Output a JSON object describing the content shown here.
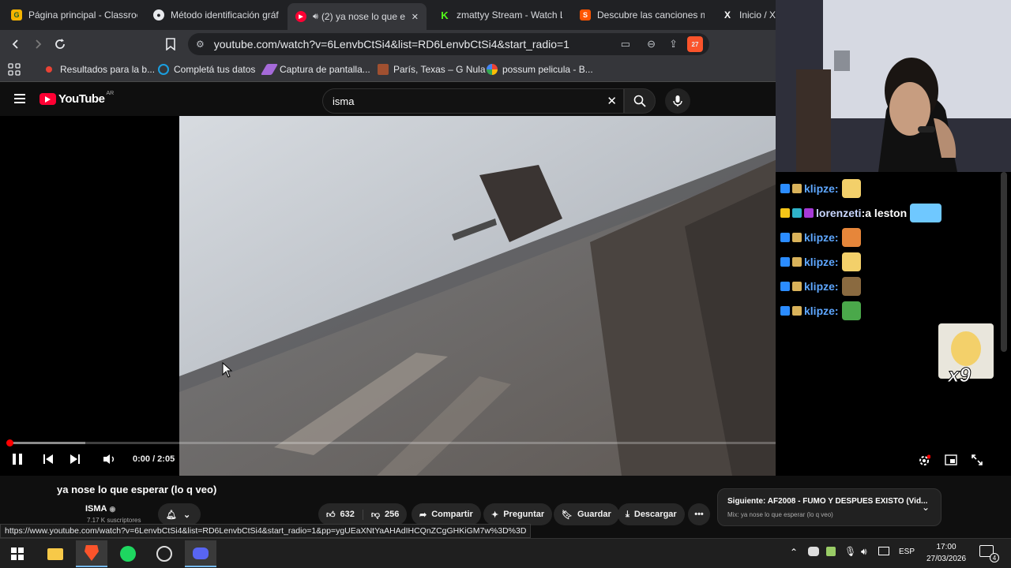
{
  "tabs": [
    {
      "title": "Página principal - Classroo",
      "fav": "G"
    },
    {
      "title": "Método identificación gráf",
      "fav": "●"
    },
    {
      "title": "(2) ya nose lo que e",
      "fav": "▶",
      "active": true
    },
    {
      "title": "zmattyy Stream - Watch Li",
      "fav": "K"
    },
    {
      "title": "Descubre las canciones m",
      "fav": "S"
    },
    {
      "title": "Inicio / X",
      "fav": "X"
    }
  ],
  "tab_close": "✕",
  "url": "youtube.com/watch?v=6LenvbCtSi4&list=RD6LenvbCtSi4&start_radio=1",
  "brave_count": "27",
  "bookmarks": [
    {
      "label": "Resultados para la b...",
      "color": "#ea4335"
    },
    {
      "label": "Completá tus datos",
      "color": "#1a9fe0"
    },
    {
      "label": "Captura de pantalla...",
      "color": "#a56ad9"
    },
    {
      "label": "París, Texas – G Nula",
      "color": "#a05030"
    },
    {
      "label": "possum pelicula - B...",
      "color": "#4285f4"
    }
  ],
  "youtube": {
    "logo": "YouTube",
    "region": "AR",
    "search_value": "isma"
  },
  "player": {
    "time": "0:00 / 2:05",
    "progress": 0.0
  },
  "video": {
    "title": "ya nose lo que esperar (lo q veo)",
    "channel": "ISMA",
    "subs": "7.17 K suscriptores",
    "likes": "632",
    "dislikes": "256",
    "share": "Compartir",
    "ask": "Preguntar",
    "save": "Guardar",
    "download": "Descargar"
  },
  "next": {
    "label": "Siguiente: AF2008 - FUMO Y DESPUES EXISTO (Vid...",
    "sub": "Mix: ya nose lo que esperar (lo q veo)"
  },
  "status_url": "https://www.youtube.com/watch?v=6LenvbCtSi4&list=RD6LenvbCtSi4&start_radio=1&pp=ygUEaXNtYaAHAdIHCQnZCgGHKiGM7w%3D%3D",
  "chat": [
    {
      "user": "klipze",
      "sep": ":",
      "text": "",
      "user_color": "#5ea7ff",
      "emote": "#f3d06a"
    },
    {
      "user": "lorenzeti",
      "sep": ":",
      "text": " a leston",
      "user_color": "#c9d7ff",
      "emote": "#6fc8ff"
    },
    {
      "user": "klipze",
      "sep": ":",
      "text": "",
      "user_color": "#5ea7ff",
      "emote": "#e6863a"
    },
    {
      "user": "klipze",
      "sep": ":",
      "text": "",
      "user_color": "#5ea7ff",
      "emote": "#f3d06a"
    },
    {
      "user": "klipze",
      "sep": ":",
      "text": "",
      "user_color": "#5ea7ff",
      "emote": "#8a6a40"
    },
    {
      "user": "klipze",
      "sep": ":",
      "text": "",
      "user_color": "#5ea7ff",
      "emote": "#4aa84a"
    }
  ],
  "emote_combo": "x9",
  "taskbar": {
    "lang": "ESP",
    "time": "17:00",
    "date": "27/03/2026",
    "notif": "4"
  }
}
